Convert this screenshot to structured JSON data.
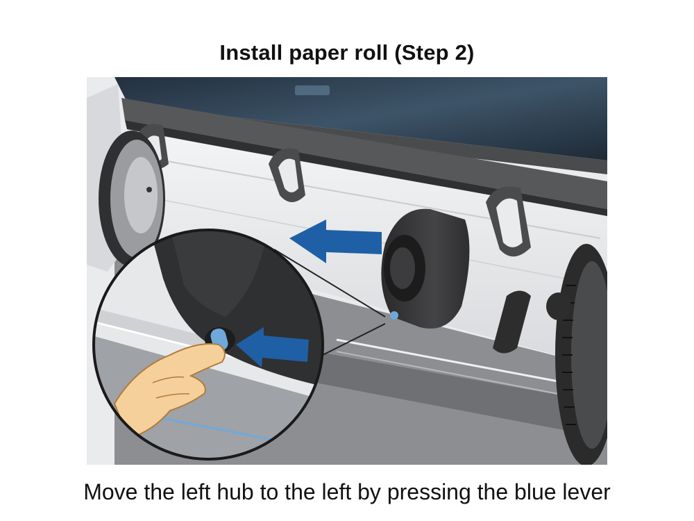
{
  "slide": {
    "title": "Install paper roll (Step 2)",
    "caption": "Move the left hub to the left by pressing the blue lever"
  },
  "illustration": {
    "subject": "printer-paper-roll-hub",
    "colors": {
      "printer_dark": "#3b3b3c",
      "printer_mid": "#6a6b6d",
      "printer_light": "#e4e6e8",
      "window_blue": "#2c3e50",
      "arrow_blue": "#1f5fa6",
      "lever_blue": "#6fa9db",
      "skin": "#f6d09a"
    }
  }
}
